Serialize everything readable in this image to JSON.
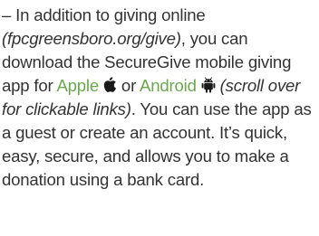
{
  "paragraph": {
    "dash": "–",
    "intro": " In addition to giving online ",
    "give_url": "(fpcgreensboro.org/give)",
    "after_url": ", you can download the SecureGive mobile giving app for ",
    "apple_link": "Apple",
    "or_text": " or ",
    "android_link": "Android",
    "scroll_note": " (scroll over for clickable links)",
    "closing": ". You can use the app as a guest or create an account. It’s quick, easy, secure, and allows you to make a donation using a bank card."
  },
  "icons": {
    "apple": "apple-logo-icon",
    "android": "android-robot-icon"
  },
  "colors": {
    "text": "#333333",
    "link": "#69a84f",
    "icon": "#1a1a1a"
  }
}
